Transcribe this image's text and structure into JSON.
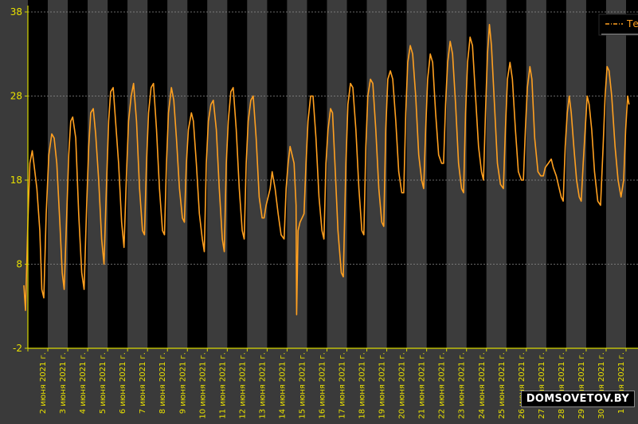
{
  "chart_data": {
    "type": "line",
    "title": "",
    "xlabel": "",
    "ylabel": "",
    "ylim": [
      -2,
      38
    ],
    "yticks": [
      -2,
      8,
      18,
      28,
      38
    ],
    "xlim": [
      0.75,
      31.2
    ],
    "grid": "horizontal dashed",
    "legend_placement": "top-right (partially clipped)",
    "colors": {
      "background": "#3a3a3a",
      "day_band_dark": "#000000",
      "day_band_light": "#3c3c3c",
      "axis": "#d8d800",
      "tick_label": "#e8e000",
      "grid": "#8a8a8a",
      "series": "#ffa020"
    },
    "date_labels": [
      "2 июня 2021 г.",
      "3 июня 2021 г.",
      "4 июня 2021 г.",
      "5 июня 2021 г.",
      "6 июня 2021 г.",
      "7 июня 2021 г.",
      "8 июня 2021 г.",
      "9 июня 2021 г.",
      "10 июня 2021 г.",
      "11 июня 2021 г.",
      "12 июня 2021 г.",
      "13 июня 2021 г.",
      "14 июня 2021 г.",
      "15 июня 2021 г.",
      "16 июня 2021 г.",
      "17 июня 2021 г.",
      "18 июня 2021 г.",
      "19 июня 2021 г.",
      "20 июня 2021 г.",
      "21 июня 2021 г.",
      "22 июня 2021 г.",
      "23 июня 2021 г.",
      "24 июня 2021 г.",
      "25 июня 2021 г.",
      "26 июня 2021 г.",
      "27 июня 2021 г.",
      "28 июня 2021 г.",
      "29 июня 2021 г.",
      "30 июня 2021 г.",
      "1 июля 2021 г."
    ],
    "series": [
      {
        "name": "Те",
        "x_unit": "day of June 2021",
        "points": [
          [
            0.8,
            5.5
          ],
          [
            0.88,
            2.5
          ],
          [
            1.0,
            13
          ],
          [
            1.1,
            20
          ],
          [
            1.22,
            21.5
          ],
          [
            1.3,
            20
          ],
          [
            1.45,
            17
          ],
          [
            1.6,
            12
          ],
          [
            1.7,
            5
          ],
          [
            1.8,
            4
          ],
          [
            1.92,
            14
          ],
          [
            2.05,
            21
          ],
          [
            2.2,
            23.5
          ],
          [
            2.32,
            23
          ],
          [
            2.45,
            20
          ],
          [
            2.6,
            13
          ],
          [
            2.72,
            7
          ],
          [
            2.82,
            5
          ],
          [
            2.95,
            14
          ],
          [
            3.05,
            21
          ],
          [
            3.15,
            25
          ],
          [
            3.25,
            25.5
          ],
          [
            3.4,
            23
          ],
          [
            3.55,
            14
          ],
          [
            3.7,
            7
          ],
          [
            3.82,
            5
          ],
          [
            3.95,
            15
          ],
          [
            4.05,
            22
          ],
          [
            4.15,
            26
          ],
          [
            4.28,
            26.5
          ],
          [
            4.4,
            23.5
          ],
          [
            4.55,
            18
          ],
          [
            4.7,
            11
          ],
          [
            4.82,
            8
          ],
          [
            4.95,
            18
          ],
          [
            5.05,
            25
          ],
          [
            5.15,
            28.5
          ],
          [
            5.28,
            29
          ],
          [
            5.4,
            25
          ],
          [
            5.55,
            20
          ],
          [
            5.7,
            13
          ],
          [
            5.82,
            10
          ],
          [
            5.95,
            19
          ],
          [
            6.05,
            25
          ],
          [
            6.18,
            28
          ],
          [
            6.3,
            29.5
          ],
          [
            6.45,
            25
          ],
          [
            6.6,
            17
          ],
          [
            6.75,
            12
          ],
          [
            6.85,
            11.5
          ],
          [
            6.95,
            20
          ],
          [
            7.05,
            26
          ],
          [
            7.18,
            29
          ],
          [
            7.3,
            29.5
          ],
          [
            7.45,
            24
          ],
          [
            7.6,
            17
          ],
          [
            7.75,
            12
          ],
          [
            7.85,
            11.5
          ],
          [
            7.95,
            20
          ],
          [
            8.05,
            26
          ],
          [
            8.2,
            29
          ],
          [
            8.32,
            27.5
          ],
          [
            8.45,
            23
          ],
          [
            8.6,
            17
          ],
          [
            8.75,
            13.5
          ],
          [
            8.85,
            13
          ],
          [
            8.95,
            20
          ],
          [
            9.05,
            24
          ],
          [
            9.2,
            26
          ],
          [
            9.3,
            25
          ],
          [
            9.45,
            20
          ],
          [
            9.6,
            14
          ],
          [
            9.75,
            11
          ],
          [
            9.85,
            9.5
          ],
          [
            9.95,
            20
          ],
          [
            10.05,
            25
          ],
          [
            10.18,
            27
          ],
          [
            10.3,
            27.5
          ],
          [
            10.45,
            24
          ],
          [
            10.6,
            17
          ],
          [
            10.75,
            11
          ],
          [
            10.85,
            9.5
          ],
          [
            10.95,
            20
          ],
          [
            11.05,
            25
          ],
          [
            11.18,
            28.5
          ],
          [
            11.3,
            29
          ],
          [
            11.45,
            24
          ],
          [
            11.6,
            17
          ],
          [
            11.75,
            12
          ],
          [
            11.85,
            11
          ],
          [
            11.95,
            20
          ],
          [
            12.05,
            25
          ],
          [
            12.18,
            27.5
          ],
          [
            12.3,
            28
          ],
          [
            12.45,
            23
          ],
          [
            12.6,
            16
          ],
          [
            12.75,
            13.5
          ],
          [
            12.85,
            13.5
          ],
          [
            12.95,
            15
          ],
          [
            13.05,
            16
          ],
          [
            13.15,
            17
          ],
          [
            13.25,
            19
          ],
          [
            13.4,
            17
          ],
          [
            13.55,
            14
          ],
          [
            13.7,
            11.5
          ],
          [
            13.85,
            11
          ],
          [
            13.95,
            17
          ],
          [
            14.05,
            20
          ],
          [
            14.15,
            22
          ],
          [
            14.25,
            21
          ],
          [
            14.35,
            20
          ],
          [
            14.45,
            15
          ],
          [
            14.48,
            2
          ],
          [
            14.55,
            12
          ],
          [
            14.65,
            13
          ],
          [
            14.85,
            14
          ],
          [
            14.95,
            20
          ],
          [
            15.05,
            25
          ],
          [
            15.18,
            28
          ],
          [
            15.3,
            28
          ],
          [
            15.45,
            23
          ],
          [
            15.6,
            16
          ],
          [
            15.75,
            12
          ],
          [
            15.85,
            11
          ],
          [
            15.95,
            20
          ],
          [
            16.05,
            24
          ],
          [
            16.18,
            26.5
          ],
          [
            16.28,
            26
          ],
          [
            16.4,
            20
          ],
          [
            16.55,
            12
          ],
          [
            16.72,
            7
          ],
          [
            16.82,
            6.5
          ],
          [
            16.95,
            20
          ],
          [
            17.05,
            27
          ],
          [
            17.18,
            29.5
          ],
          [
            17.3,
            29
          ],
          [
            17.45,
            24
          ],
          [
            17.6,
            17
          ],
          [
            17.75,
            12
          ],
          [
            17.85,
            11.5
          ],
          [
            17.95,
            22
          ],
          [
            18.05,
            28
          ],
          [
            18.18,
            30
          ],
          [
            18.3,
            29.5
          ],
          [
            18.45,
            24
          ],
          [
            18.6,
            17
          ],
          [
            18.75,
            13
          ],
          [
            18.85,
            12.5
          ],
          [
            18.95,
            24
          ],
          [
            19.05,
            30
          ],
          [
            19.18,
            31
          ],
          [
            19.3,
            30
          ],
          [
            19.45,
            25
          ],
          [
            19.6,
            19
          ],
          [
            19.75,
            16.5
          ],
          [
            19.85,
            16.5
          ],
          [
            19.95,
            26
          ],
          [
            20.05,
            32
          ],
          [
            20.18,
            34
          ],
          [
            20.3,
            33
          ],
          [
            20.45,
            28
          ],
          [
            20.6,
            21
          ],
          [
            20.75,
            18
          ],
          [
            20.85,
            17
          ],
          [
            20.95,
            24
          ],
          [
            21.05,
            30
          ],
          [
            21.18,
            33
          ],
          [
            21.3,
            32
          ],
          [
            21.45,
            26
          ],
          [
            21.6,
            21
          ],
          [
            21.75,
            20
          ],
          [
            21.85,
            20
          ],
          [
            21.95,
            27
          ],
          [
            22.05,
            32
          ],
          [
            22.18,
            34.5
          ],
          [
            22.3,
            33
          ],
          [
            22.45,
            27
          ],
          [
            22.6,
            20
          ],
          [
            22.75,
            17
          ],
          [
            22.85,
            16.5
          ],
          [
            22.95,
            26
          ],
          [
            23.05,
            32
          ],
          [
            23.18,
            35
          ],
          [
            23.3,
            34
          ],
          [
            23.45,
            28
          ],
          [
            23.6,
            22
          ],
          [
            23.75,
            19
          ],
          [
            23.85,
            18
          ],
          [
            23.95,
            26
          ],
          [
            24.05,
            33
          ],
          [
            24.15,
            36.5
          ],
          [
            24.25,
            34
          ],
          [
            24.4,
            27
          ],
          [
            24.55,
            20
          ],
          [
            24.7,
            17.5
          ],
          [
            24.85,
            17
          ],
          [
            24.95,
            24
          ],
          [
            25.05,
            30
          ],
          [
            25.18,
            32
          ],
          [
            25.3,
            30
          ],
          [
            25.45,
            24
          ],
          [
            25.6,
            19
          ],
          [
            25.75,
            18
          ],
          [
            25.85,
            18
          ],
          [
            25.95,
            24
          ],
          [
            26.05,
            29
          ],
          [
            26.18,
            31.5
          ],
          [
            26.28,
            30
          ],
          [
            26.42,
            23
          ],
          [
            26.58,
            19
          ],
          [
            26.72,
            18.5
          ],
          [
            26.85,
            18.5
          ],
          [
            26.95,
            19.5
          ],
          [
            27.1,
            20
          ],
          [
            27.25,
            20.5
          ],
          [
            27.35,
            19.5
          ],
          [
            27.5,
            18.5
          ],
          [
            27.65,
            17
          ],
          [
            27.75,
            16
          ],
          [
            27.85,
            15.5
          ],
          [
            27.95,
            22
          ],
          [
            28.05,
            26
          ],
          [
            28.15,
            28
          ],
          [
            28.25,
            26
          ],
          [
            28.38,
            22
          ],
          [
            28.52,
            18
          ],
          [
            28.65,
            16
          ],
          [
            28.75,
            15.5
          ],
          [
            28.85,
            20
          ],
          [
            28.95,
            24
          ],
          [
            29.05,
            28
          ],
          [
            29.15,
            27
          ],
          [
            29.28,
            24
          ],
          [
            29.42,
            19
          ],
          [
            29.58,
            15.5
          ],
          [
            29.72,
            15
          ],
          [
            29.85,
            22
          ],
          [
            29.95,
            28
          ],
          [
            30.05,
            31.5
          ],
          [
            30.15,
            31
          ],
          [
            30.28,
            28
          ],
          [
            30.45,
            22
          ],
          [
            30.6,
            18
          ],
          [
            30.75,
            16
          ],
          [
            30.88,
            18
          ],
          [
            30.98,
            24
          ],
          [
            31.08,
            28
          ],
          [
            31.15,
            27
          ]
        ]
      }
    ]
  },
  "legend": {
    "label": "Те"
  },
  "watermark": {
    "text": "DOMSOVETOV.BY"
  }
}
